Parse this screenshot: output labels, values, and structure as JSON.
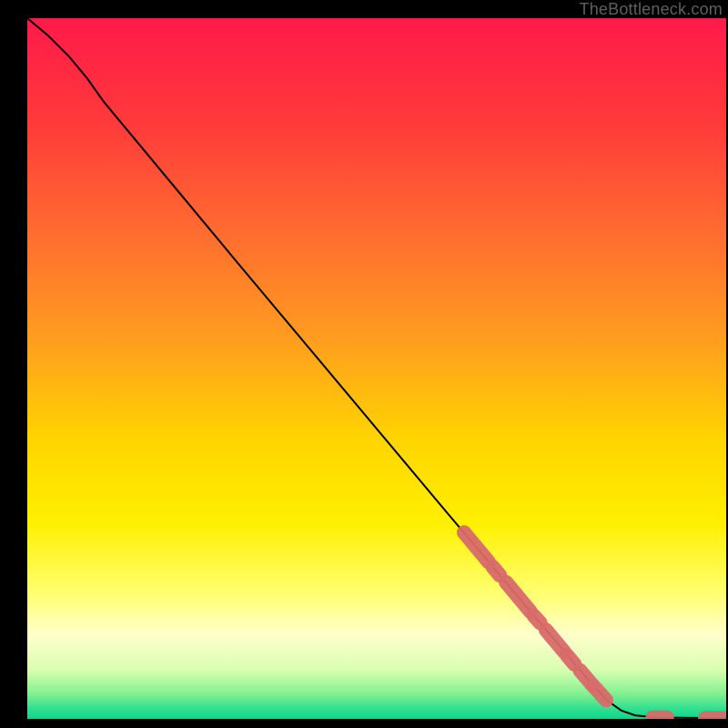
{
  "attribution": "TheBottleneck.com",
  "colors": {
    "line": "#000000",
    "marker_fill": "#d96b6b",
    "marker_stroke": "#d96b6b"
  },
  "gradient": [
    {
      "offset": 0.0,
      "color": "#ff1a4a"
    },
    {
      "offset": 0.15,
      "color": "#ff3a3a"
    },
    {
      "offset": 0.3,
      "color": "#ff6a30"
    },
    {
      "offset": 0.45,
      "color": "#ff9a20"
    },
    {
      "offset": 0.6,
      "color": "#ffd400"
    },
    {
      "offset": 0.72,
      "color": "#fff000"
    },
    {
      "offset": 0.82,
      "color": "#ffff70"
    },
    {
      "offset": 0.88,
      "color": "#ffffcc"
    },
    {
      "offset": 0.93,
      "color": "#d8ffb0"
    },
    {
      "offset": 0.965,
      "color": "#80f090"
    },
    {
      "offset": 0.985,
      "color": "#30e090"
    },
    {
      "offset": 1.0,
      "color": "#10d488"
    }
  ],
  "chart_data": {
    "type": "line",
    "title": "",
    "xlabel": "",
    "ylabel": "",
    "xlim": [
      0,
      100
    ],
    "ylim": [
      0,
      100
    ],
    "curve": [
      {
        "x": 0,
        "y": 100
      },
      {
        "x": 3,
        "y": 97.5
      },
      {
        "x": 6,
        "y": 94.5
      },
      {
        "x": 8.5,
        "y": 91.5
      },
      {
        "x": 11,
        "y": 88.0
      },
      {
        "x": 20,
        "y": 77.2
      },
      {
        "x": 30,
        "y": 65.2
      },
      {
        "x": 40,
        "y": 53.3
      },
      {
        "x": 50,
        "y": 41.4
      },
      {
        "x": 60,
        "y": 29.5
      },
      {
        "x": 65,
        "y": 23.6
      },
      {
        "x": 70,
        "y": 17.7
      },
      {
        "x": 75,
        "y": 11.8
      },
      {
        "x": 80,
        "y": 5.9
      },
      {
        "x": 83,
        "y": 2.6
      },
      {
        "x": 85,
        "y": 1.2
      },
      {
        "x": 87,
        "y": 0.5
      },
      {
        "x": 90,
        "y": 0.2
      },
      {
        "x": 95,
        "y": 0.15
      },
      {
        "x": 100,
        "y": 0.1
      }
    ],
    "marker_segments": [
      {
        "x1": 62.5,
        "y1": 26.6,
        "x2": 66.0,
        "y2": 22.4
      },
      {
        "x1": 66.6,
        "y1": 21.7,
        "x2": 67.6,
        "y2": 20.5
      },
      {
        "x1": 68.5,
        "y1": 19.5,
        "x2": 72.0,
        "y2": 15.3
      },
      {
        "x1": 72.5,
        "y1": 14.7,
        "x2": 73.4,
        "y2": 13.7
      },
      {
        "x1": 74.2,
        "y1": 12.7,
        "x2": 76.8,
        "y2": 9.6
      },
      {
        "x1": 77.2,
        "y1": 9.1,
        "x2": 78.3,
        "y2": 7.8
      },
      {
        "x1": 79.1,
        "y1": 6.9,
        "x2": 80.8,
        "y2": 4.9
      },
      {
        "x1": 81.0,
        "y1": 4.7,
        "x2": 82.8,
        "y2": 2.7
      },
      {
        "x1": 89.5,
        "y1": 0.2,
        "x2": 91.5,
        "y2": 0.2
      },
      {
        "x1": 97.0,
        "y1": 0.1,
        "x2": 99.5,
        "y2": 0.1
      }
    ],
    "marker_radius": 8
  }
}
